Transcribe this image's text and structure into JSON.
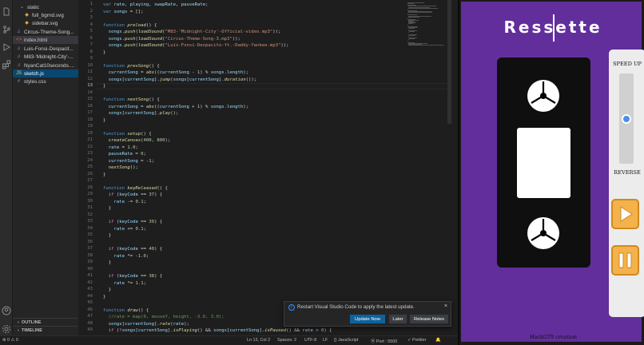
{
  "explorer": {
    "items": [
      {
        "label": "static",
        "type": "folder"
      },
      {
        "label": "full_bgrnd.svg",
        "type": "svg"
      },
      {
        "label": "sidebar.svg",
        "type": "svg"
      },
      {
        "label": "Circus-Theme-Song...",
        "type": "mp3"
      },
      {
        "label": "index.html",
        "type": "html"
      },
      {
        "label": "Luis-Fonsi-Despacit...",
        "type": "mp3"
      },
      {
        "label": "M83-'Midnight-City'-...",
        "type": "mp3"
      },
      {
        "label": "NyanCat10seconds....",
        "type": "mp3"
      },
      {
        "label": "sketch.js",
        "type": "js"
      },
      {
        "label": "styles.css",
        "type": "css"
      }
    ],
    "outline": "OUTLINE",
    "timeline": "TIMELINE"
  },
  "editor": {
    "current_line": 13,
    "lines": [
      "var rate, playing, swapRate, pauseRate;",
      "var songs = [];",
      "",
      "function preload() {",
      "  songs.push(loadSound(\"M83-'Midnight-City'-Official-video.mp3\"));",
      "  songs.push(loadSound(\"Circus-Theme-Song-3.mp3\"));",
      "  songs.push(loadSound(\"Luis-Fonsi-Despacito-ft.-Daddy-Yankee.mp3\"));",
      "}",
      "",
      "function prevSong() {",
      "  currentSong = abs((currentSong - 1) % songs.length);",
      "  songs[currentSong].jump(songs[currentSong].duration());",
      "}",
      "",
      "function nextSong() {",
      "  currentSong = abs((currentSong + 1) % songs.length);",
      "  songs[currentSong].play();",
      "}",
      "",
      "function setup() {",
      "  createCanvas(400, 800);",
      "  rate = 1.0;",
      "  pauseRate = 0;",
      "  currentSong = -1;",
      "  nextSong();",
      "}",
      "",
      "function keyReleased() {",
      "  if (keyCode == 37) {",
      "    rate -= 0.1;",
      "  }",
      "",
      "  if (keyCode == 39) {",
      "    rate += 0.1;",
      "  }",
      "",
      "  if (keyCode == 40) {",
      "    rate *= -1.0;",
      "  }",
      "",
      "  if (keyCode == 38) {",
      "    rate *= 1.1;",
      "  }",
      "}",
      "",
      "function draw() {",
      "  //rate = map(0, mouseY, height, -3.0, 3.0);",
      "  songs[currentSong].rate(rate);",
      "  if (!songs[currentSong].isPlaying() && songs[currentSong].isPaused() && rate > 0) {"
    ]
  },
  "notification": {
    "message": "Restart Visual Studio Code to apply the latest update.",
    "update_label": "Update Now",
    "later_label": "Later",
    "notes_label": "Release Notes",
    "close": "×"
  },
  "status": {
    "errors": "⊗ 0 ⚠ 0",
    "position": "Ln 13, Col 2",
    "spaces": "Spaces: 2",
    "encoding": "UTF-8",
    "eol": "LF",
    "language": "{} JavaScript",
    "port": "⦿ Port : 5500",
    "prettier": "✓ Prettier"
  },
  "preview": {
    "logo": "Ressette",
    "speed_up": "SPEED UP",
    "reverse": "REVERSE",
    "credit": "HackGT9 creation",
    "speed_level": 0.5,
    "accent": "#622e9c",
    "button_color": "#f4b24c"
  }
}
